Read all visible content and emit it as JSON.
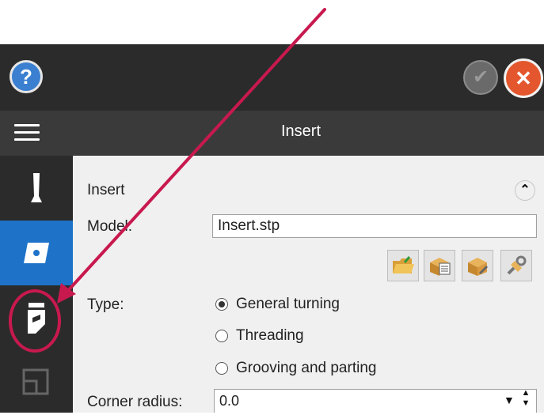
{
  "window": {
    "title": "Insert",
    "icons": [
      "help-icon",
      "ok-icon",
      "close-icon",
      "menu-icon"
    ]
  },
  "sidebar": {
    "items": [
      {
        "icon": "tool-holder-icon",
        "active": false
      },
      {
        "icon": "insert-icon",
        "active": true
      },
      {
        "icon": "tool-assembly-icon",
        "active": false
      },
      {
        "icon": "layout-icon",
        "active": false
      }
    ]
  },
  "section": {
    "title": "Insert",
    "collapse_icon": "chevron-up-icon"
  },
  "model": {
    "label": "Model:",
    "value": "Insert.stp",
    "toolbar_icons": [
      "open-folder-icon",
      "box-list-icon",
      "box-wrench-icon",
      "wrench-settings-icon"
    ]
  },
  "type": {
    "label": "Type:",
    "options": [
      {
        "label": "General turning",
        "checked": true
      },
      {
        "label": "Threading",
        "checked": false
      },
      {
        "label": "Grooving and parting",
        "checked": false
      }
    ]
  },
  "corner_radius": {
    "label": "Corner radius:",
    "value": "0.0"
  },
  "colors": {
    "titlebar": "#2b2b2b",
    "active_tab": "#1e73c8",
    "annotation": "#c8194f",
    "close": "#e4572e"
  }
}
